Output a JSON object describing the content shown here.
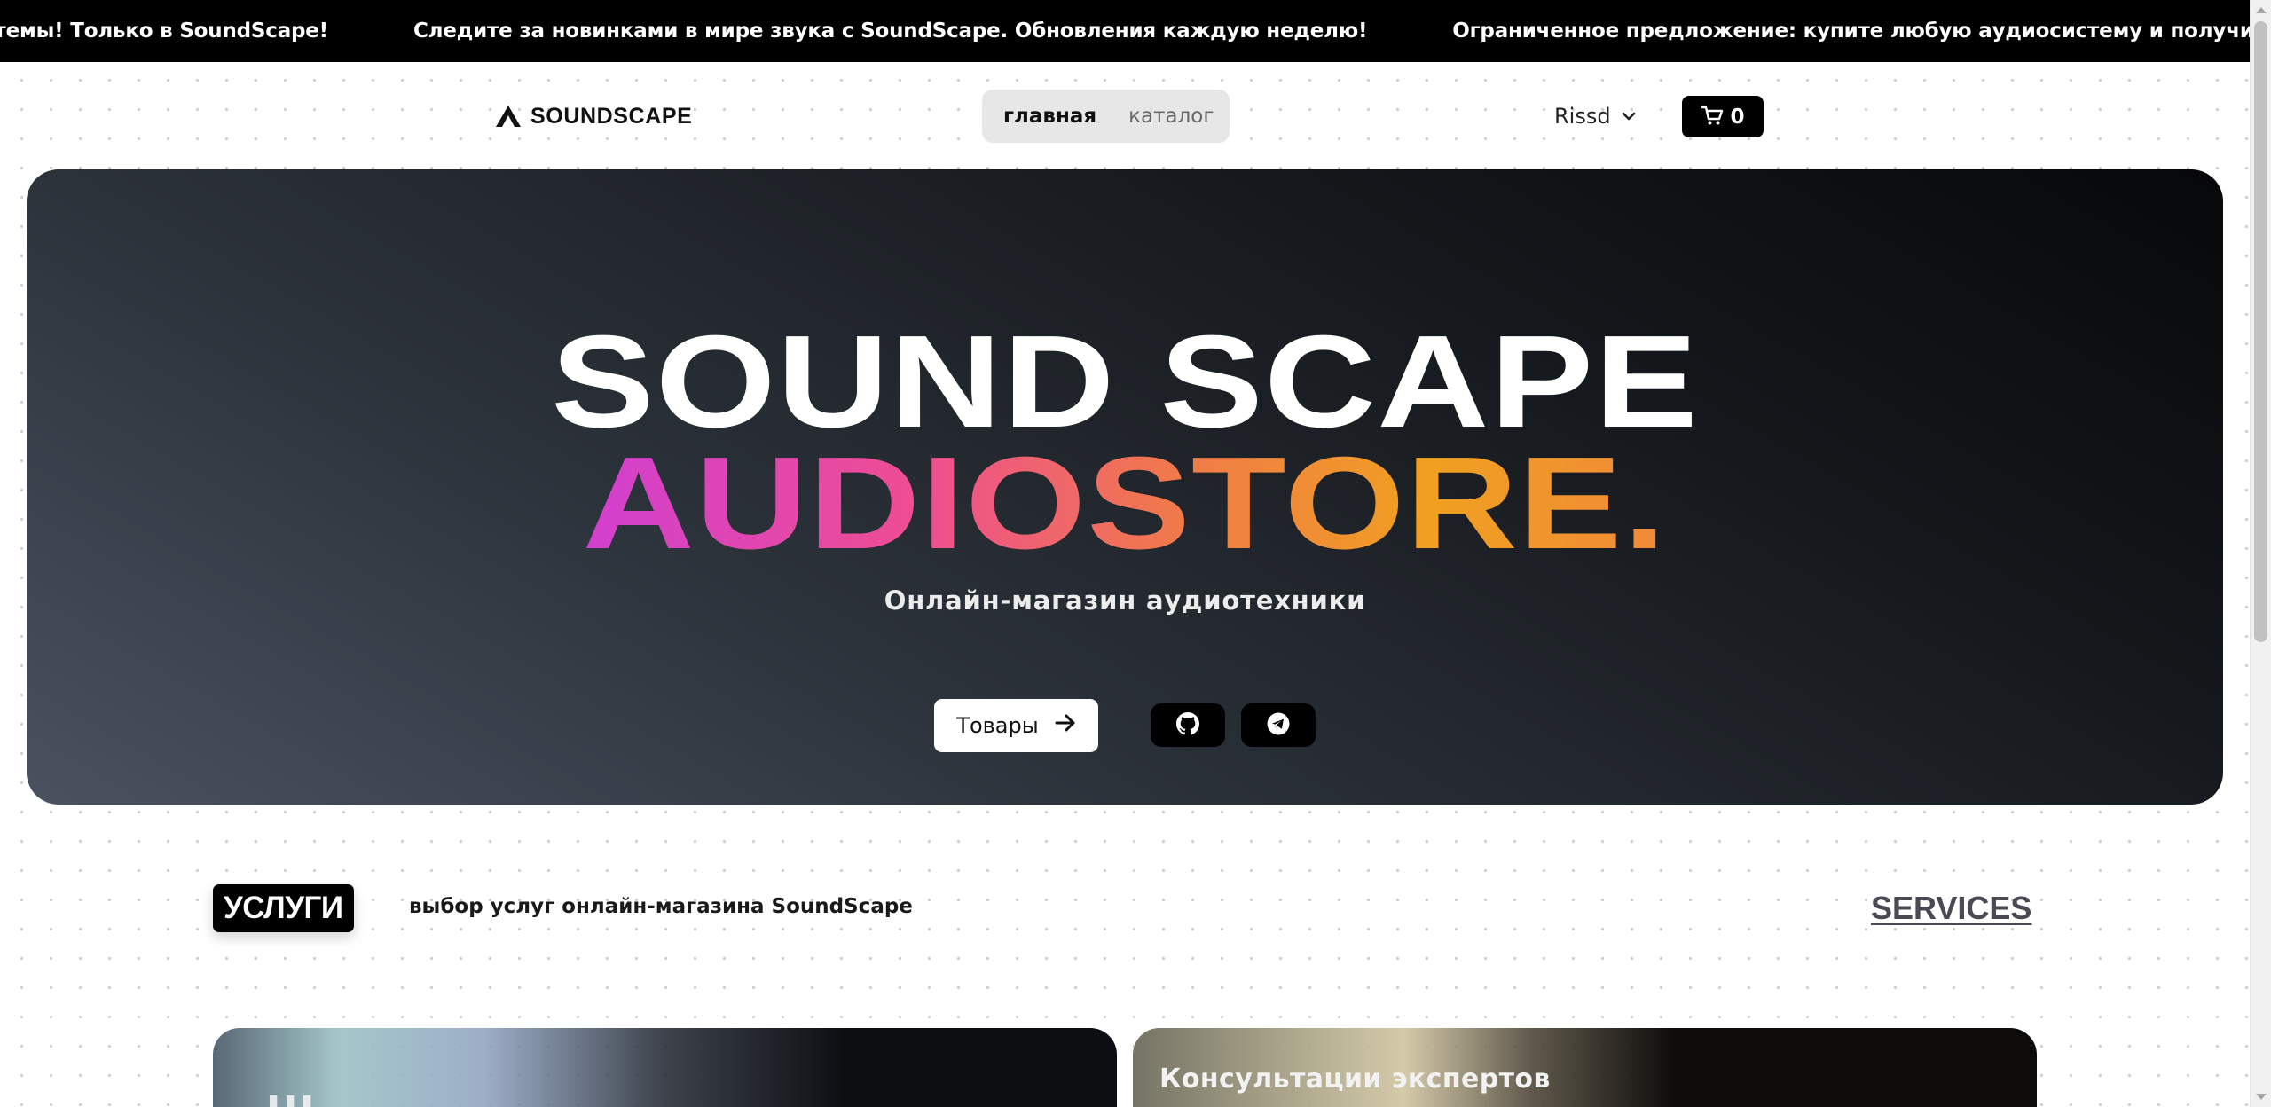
{
  "marquee": {
    "items": [
      "стемы! Только в SoundScape!",
      "Следите за новинками в мире звука с SoundScape. Обновления каждую неделю!",
      "Ограниченное предложение: купите любую аудиосистему и получите наушники в подарок!"
    ]
  },
  "header": {
    "logo_text": "SOUNDSCAPE",
    "logo_icon": "triangle-logo-icon",
    "nav": [
      {
        "label": "главная",
        "active": true
      },
      {
        "label": "каталог",
        "active": false
      }
    ],
    "user_name": "Rissd",
    "cart_count": "0"
  },
  "hero": {
    "title_line1": "SOUND SCAPE",
    "title_line2": "AUDIOSTORE.",
    "tagline": "Онлайн-магазин аудиотехники",
    "cta_label": "Товары",
    "social": [
      "github-icon",
      "telegram-icon"
    ]
  },
  "services": {
    "badge": "УСЛУГИ",
    "description": "выбор услуг онлайн-магазина SoundScape",
    "link": "SERVICES",
    "cards": [
      {
        "title": "Ш"
      },
      {
        "title": "Консультации экспертов"
      }
    ]
  },
  "colors": {
    "accent_gradient": [
      "#d13fd0",
      "#ee4d93",
      "#f07a4a",
      "#f0a020"
    ],
    "hero_bg_dark": "#070809",
    "hero_bg_light": "#4a5260"
  }
}
